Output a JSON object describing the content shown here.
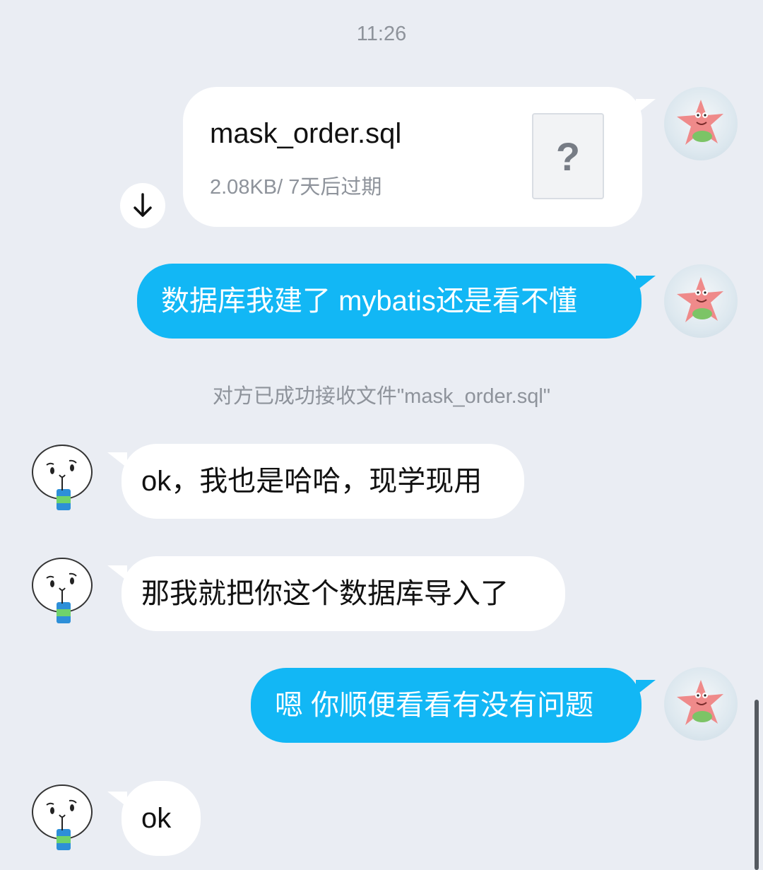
{
  "status": {
    "time": "11:26"
  },
  "file_message": {
    "filename": "mask_order.sql",
    "meta": "2.08KB/ 7天后过期",
    "icon": "unknown-file-icon",
    "download_icon": "download-arrow-icon"
  },
  "messages": [
    {
      "sender": "self",
      "text": "数据库我建了 mybatis还是看不懂"
    },
    {
      "sender": "peer",
      "text": "ok，我也是哈哈，现学现用"
    },
    {
      "sender": "peer",
      "text": "那我就把你这个数据库导入了"
    },
    {
      "sender": "self",
      "text": "嗯 你顺便看看有没有问题"
    },
    {
      "sender": "peer",
      "text": "ok"
    }
  ],
  "system_notice": "对方已成功接收文件\"mask_order.sql\"",
  "colors": {
    "self_bubble": "#12b7f5",
    "peer_bubble": "#ffffff",
    "background": "#eaedf3"
  }
}
